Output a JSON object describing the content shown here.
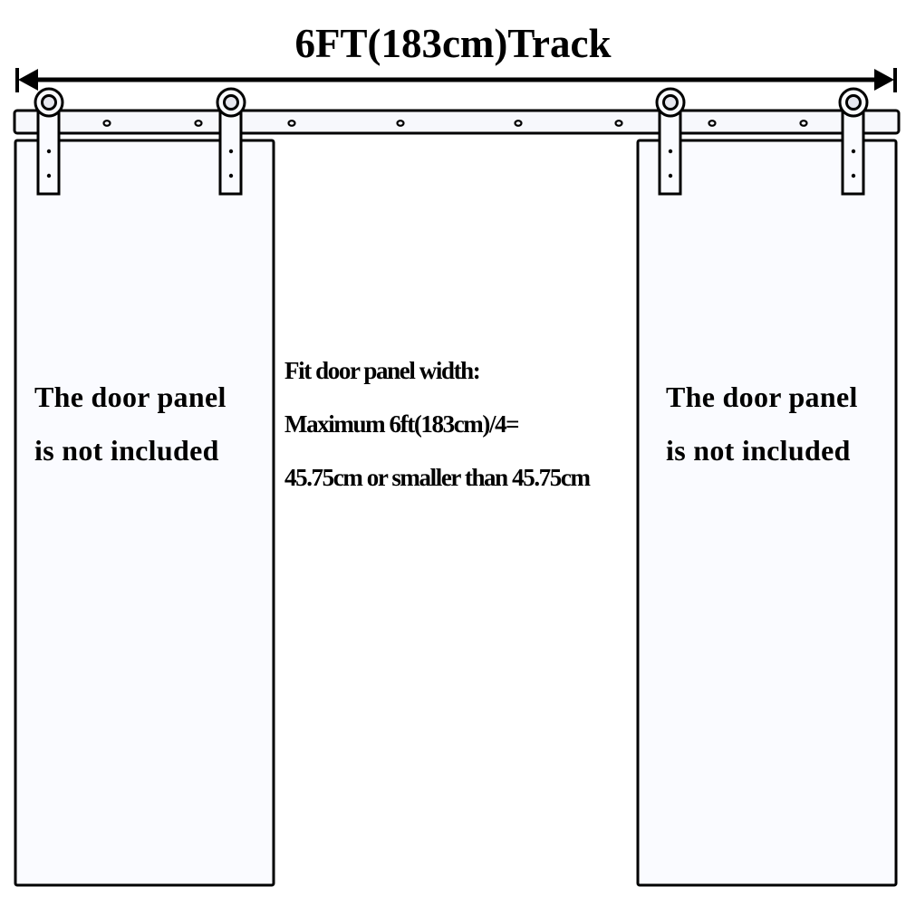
{
  "title": "6FT(183cm)Track",
  "left_panel": {
    "line1": "The door panel",
    "line2": "is not included"
  },
  "right_panel": {
    "line1": "The door panel",
    "line2": "is not included"
  },
  "middle_note": {
    "line1": "Fit door panel width:",
    "line2": "Maximum 6ft(183cm)/4=",
    "line3": "45.75cm or smaller than 45.75cm"
  },
  "colors": {
    "stroke": "#000000",
    "panel_fill": "#fafbff",
    "rail_fill": "#f7f8fc",
    "wheel_hub": "#e6e7ef"
  }
}
